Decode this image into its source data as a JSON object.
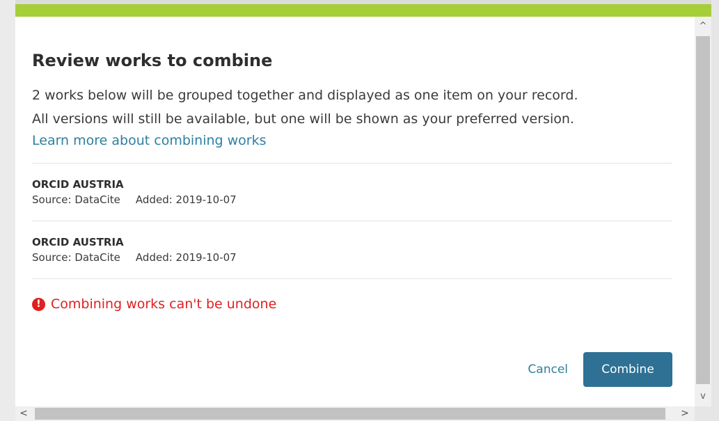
{
  "colors": {
    "accent_bar": "#a6ce39",
    "link": "#2e7f9e",
    "button_bg": "#2e7194",
    "warning": "#e02020",
    "backdrop": "#e6e6e6"
  },
  "dialog": {
    "title": "Review works to combine",
    "intro_line_1": "2 works below will be grouped together and displayed as one item on your record.",
    "intro_line_2": "All versions will still be available, but one will be shown as your preferred version.",
    "learn_more_link": "Learn more about combining works",
    "works": [
      {
        "title": "ORCID AUSTRIA",
        "source": "Source: DataCite",
        "added": "Added: 2019-10-07"
      },
      {
        "title": "ORCID AUSTRIA",
        "source": "Source: DataCite",
        "added": "Added: 2019-10-07"
      }
    ],
    "warning_icon": "exclamation-circle-icon",
    "warning_text": "Combining works can't be undone",
    "cancel_label": "Cancel",
    "combine_label": "Combine"
  },
  "scrollbars": {
    "up_arrow": "^",
    "down_arrow": "v",
    "left_arrow": "<",
    "right_arrow": ">"
  }
}
